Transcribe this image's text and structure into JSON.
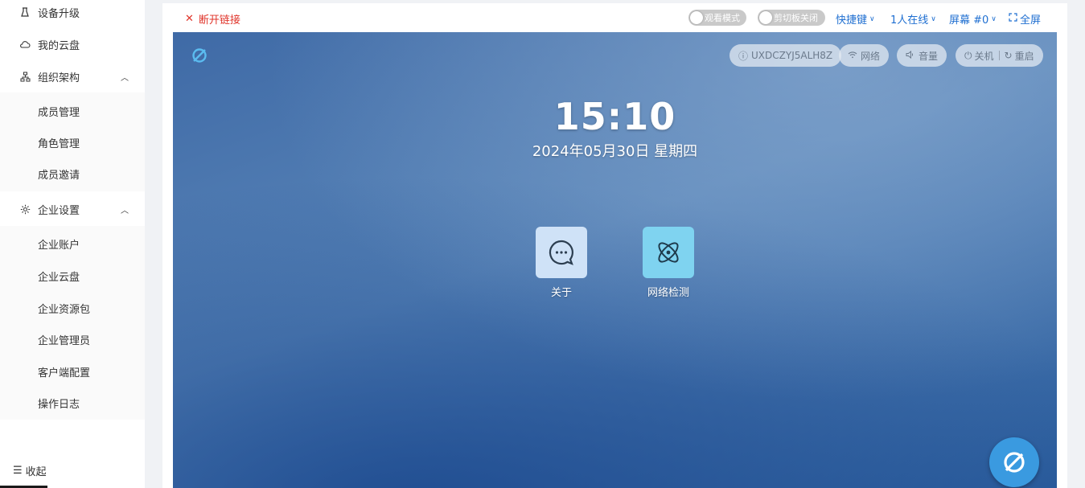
{
  "sidebar": {
    "items": [
      {
        "label": "设备升级",
        "icon": "upgrade-icon"
      },
      {
        "label": "我的云盘",
        "icon": "cloud-icon"
      },
      {
        "label": "组织架构",
        "icon": "org-icon"
      },
      {
        "label": "成员管理"
      },
      {
        "label": "角色管理"
      },
      {
        "label": "成员邀请"
      },
      {
        "label": "企业设置",
        "icon": "gear-icon"
      },
      {
        "label": "企业账户"
      },
      {
        "label": "企业云盘"
      },
      {
        "label": "企业资源包"
      },
      {
        "label": "企业管理员"
      },
      {
        "label": "客户端配置"
      },
      {
        "label": "操作日志"
      }
    ],
    "collapse_label": "收起"
  },
  "toolbar": {
    "disconnect_label": "断开链接",
    "view_mode_label": "观看模式",
    "clipboard_label": "剪切板关闭",
    "shortcut_label": "快捷键",
    "online_label": "1人在线",
    "screen_label": "屏幕 #0",
    "fullscreen_label": "全屏",
    "accent_color": "#1f6fd1",
    "danger_color": "#e0352b"
  },
  "remote": {
    "device_id": "UXDCZYJ5ALH8Z",
    "network_label": "网络",
    "volume_label": "音量",
    "shutdown_label": "关机",
    "restart_label": "重启",
    "time": "15:10",
    "date": "2024年05月30日 星期四",
    "apps": [
      {
        "label": "关于",
        "icon": "chat-bubble-icon",
        "color": "#cfe2f7"
      },
      {
        "label": "网络检测",
        "icon": "atom-icon",
        "color": "#7fd3f0"
      }
    ]
  }
}
